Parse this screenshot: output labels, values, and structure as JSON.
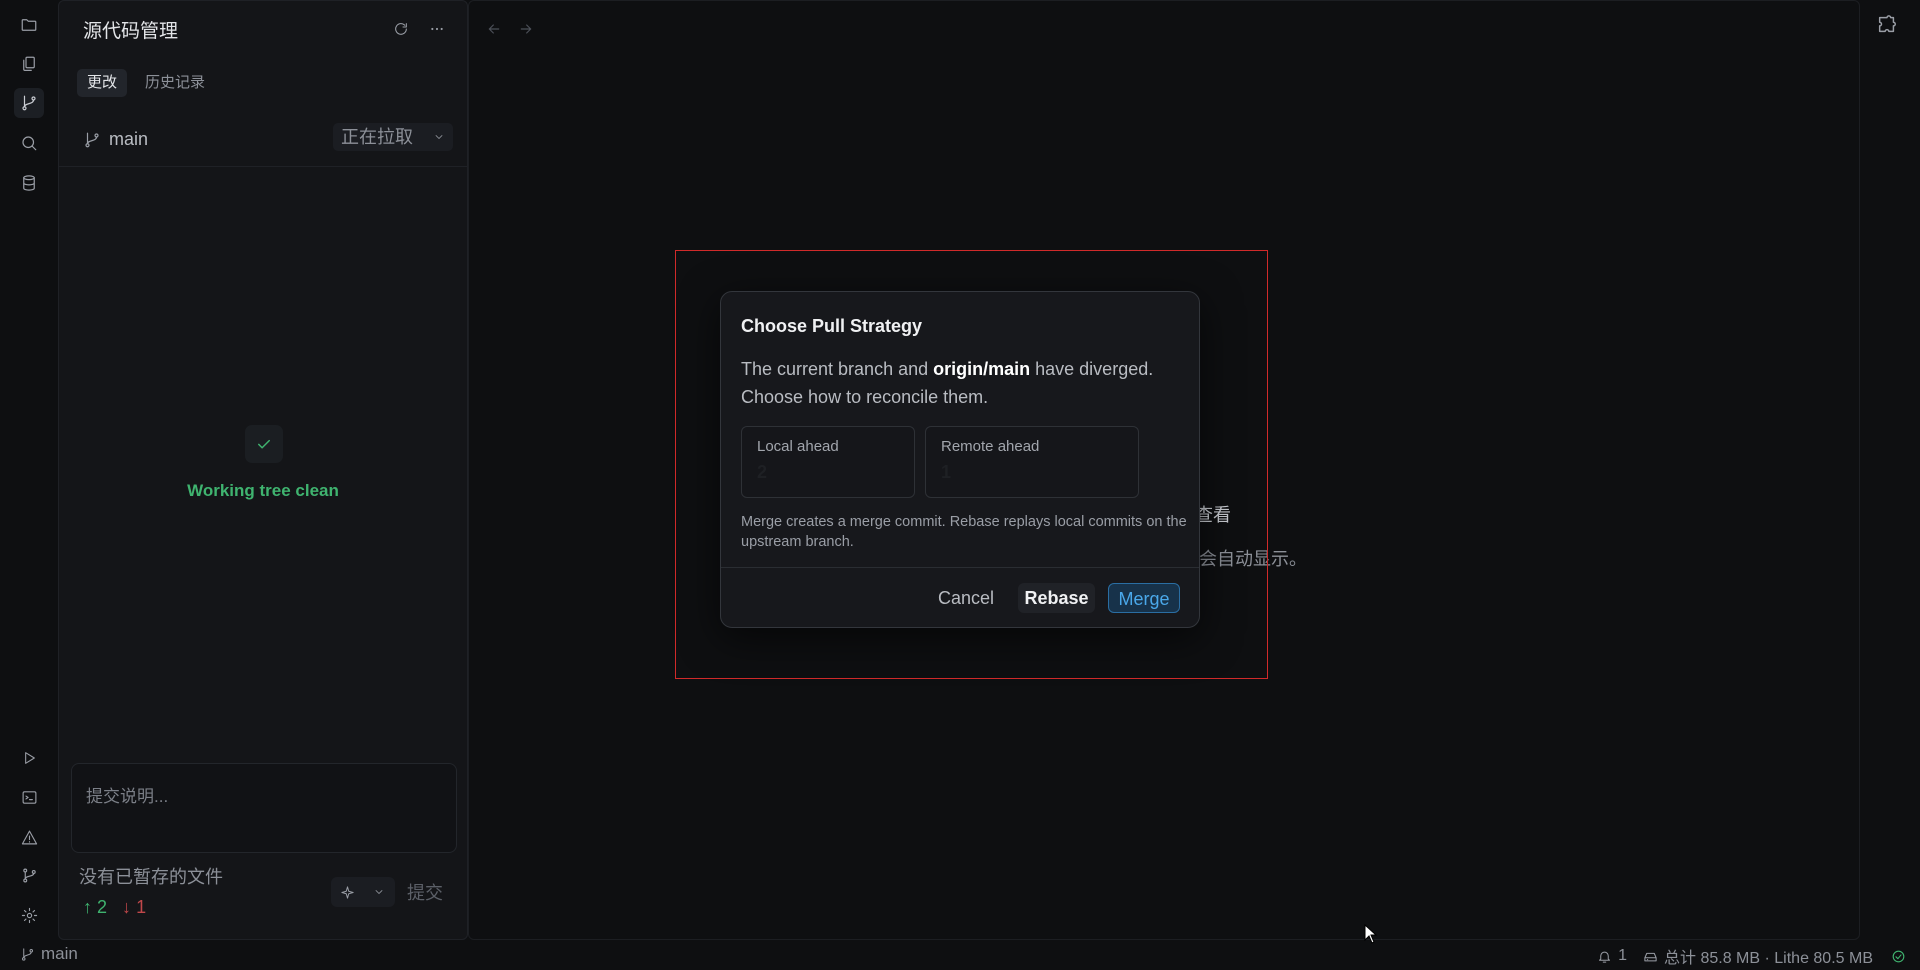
{
  "panel": {
    "title": "源代码管理",
    "tabs": [
      {
        "label": "更改"
      },
      {
        "label": "历史记录"
      }
    ],
    "branch": "main",
    "pull_status": "正在拉取",
    "clean_message": "Working tree clean",
    "commit_placeholder": "提交说明...",
    "no_staged": "没有已暂存的文件",
    "ahead": "2",
    "behind": "1",
    "commit_label": "提交"
  },
  "background_text": {
    "line1": "查看",
    "line2": "会自动显示。"
  },
  "dialog": {
    "title": "Choose Pull Strategy",
    "message_prefix": "The current branch and ",
    "message_ref": "origin/main",
    "message_suffix": " have diverged. Choose how to reconcile them.",
    "local_ahead_label": "Local ahead",
    "local_ahead_value": "2",
    "remote_ahead_label": "Remote ahead",
    "remote_ahead_value": "1",
    "note": "Merge creates a merge commit. Rebase replays local commits on the upstream branch.",
    "cancel_label": "Cancel",
    "rebase_label": "Rebase",
    "merge_label": "Merge"
  },
  "status_bar": {
    "branch": "main",
    "notifications": "1",
    "memory": "总计 85.8 MB · Lithe 80.5 MB"
  },
  "colors": {
    "accent_blue": "#4aa8ea",
    "success_green": "#3fb36f",
    "danger_red": "#c0474a"
  }
}
